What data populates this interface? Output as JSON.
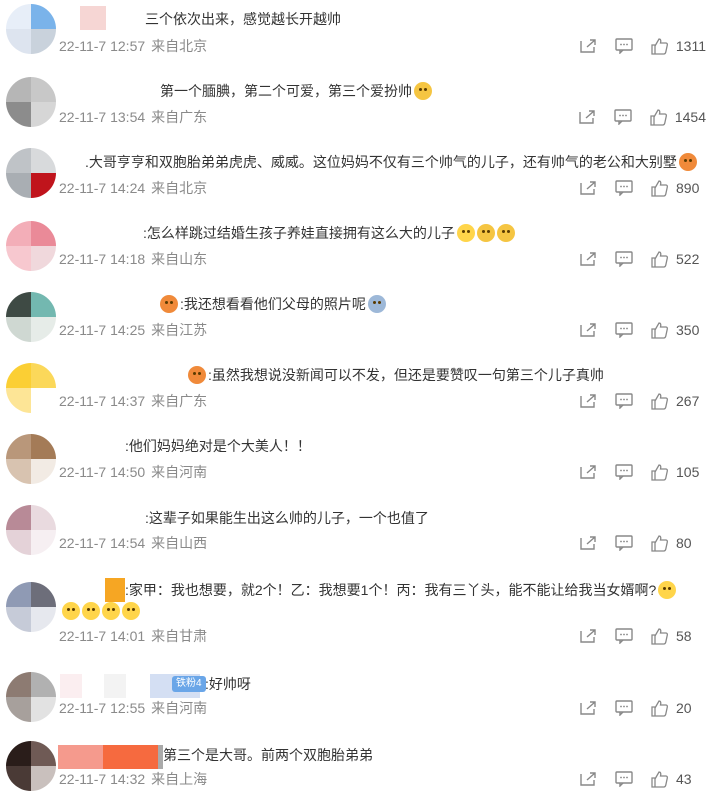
{
  "comments": [
    {
      "text": "三个依次出来，感觉越长开越帅",
      "date": "22-11-7 12:57",
      "loc": "来自北京",
      "likes": "1311"
    },
    {
      "text": "第一个腼腆，第二个可爱，第三个爱扮帅",
      "date": "22-11-7 13:54",
      "loc": "来自广东",
      "likes": "1454"
    },
    {
      "text": ".大哥亨亨和双胞胎弟弟虎虎、威威。这位妈妈不仅有三个帅气的儿子，还有帅气的老公和大别墅",
      "date": "22-11-7 14:24",
      "loc": "来自北京",
      "likes": "890"
    },
    {
      "text": ":怎么样跳过结婚生孩子养娃直接拥有这么大的儿子",
      "date": "22-11-7 14:18",
      "loc": "来自山东",
      "likes": "522"
    },
    {
      "text": ":我还想看看他们父母的照片呢",
      "date": "22-11-7 14:25",
      "loc": "来自江苏",
      "likes": "350"
    },
    {
      "text": ":虽然我想说没新闻可以不发，但还是要赞叹一句第三个儿子真帅",
      "date": "22-11-7 14:37",
      "loc": "来自广东",
      "likes": "267"
    },
    {
      "text": ":他们妈妈绝对是个大美人！！",
      "date": "22-11-7 14:50",
      "loc": "来自河南",
      "likes": "105"
    },
    {
      "text": ":这辈子如果能生出这么帅的儿子，一个也值了",
      "date": "22-11-7 14:54",
      "loc": "来自山西",
      "likes": "80"
    },
    {
      "text": ":家甲：我也想要，就2个！乙：我想要1个！丙：我有三丫头，能不能让给我当女婿啊?",
      "date": "22-11-7 14:01",
      "loc": "来自甘肃",
      "likes": "58"
    },
    {
      "text": ":好帅呀",
      "date": "22-11-7 12:55",
      "loc": "来自河南",
      "likes": "20",
      "badge": "铁粉4"
    },
    {
      "text": "第三个是大哥。前两个双胞胎弟弟",
      "date": "22-11-7 14:32",
      "loc": "来自上海",
      "likes": "43"
    }
  ],
  "icons": {
    "share": "share-icon",
    "comment": "comment-icon",
    "like": "like-icon"
  }
}
